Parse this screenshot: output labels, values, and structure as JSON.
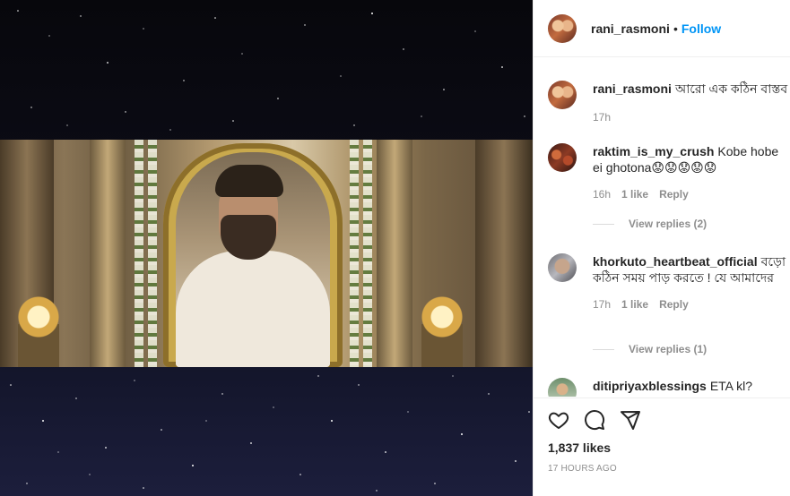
{
  "post": {
    "author": "rani_rasmoni",
    "separator": "•",
    "follow_label": "Follow"
  },
  "comments": [
    {
      "user": "rani_rasmoni",
      "text": "আরো এক কঠিন বাস্তব",
      "time": "17h",
      "likes": "",
      "reply": "",
      "replies": ""
    },
    {
      "user": "raktim_is_my_crush",
      "text": "Kobe hobe ei ghotona😟😟😟😟😟",
      "time": "16h",
      "likes": "1 like",
      "reply": "Reply",
      "replies": "View replies (2)"
    },
    {
      "user": "khorkuto_heartbeat_official",
      "text": "বড়ো কঠিন সময় পাড় করতে ! যে আমাদের",
      "time": "17h",
      "likes": "1 like",
      "reply": "Reply",
      "replies": "View replies (1)"
    },
    {
      "user": "ditipriyaxblessings",
      "text": "ETA kl?",
      "time": "",
      "likes": "",
      "reply": "",
      "replies": ""
    }
  ],
  "actions": {
    "likes": "1,837 likes",
    "time_ago": "17 HOURS AGO",
    "icons": [
      "heart-icon",
      "comment-icon",
      "share-icon"
    ]
  }
}
